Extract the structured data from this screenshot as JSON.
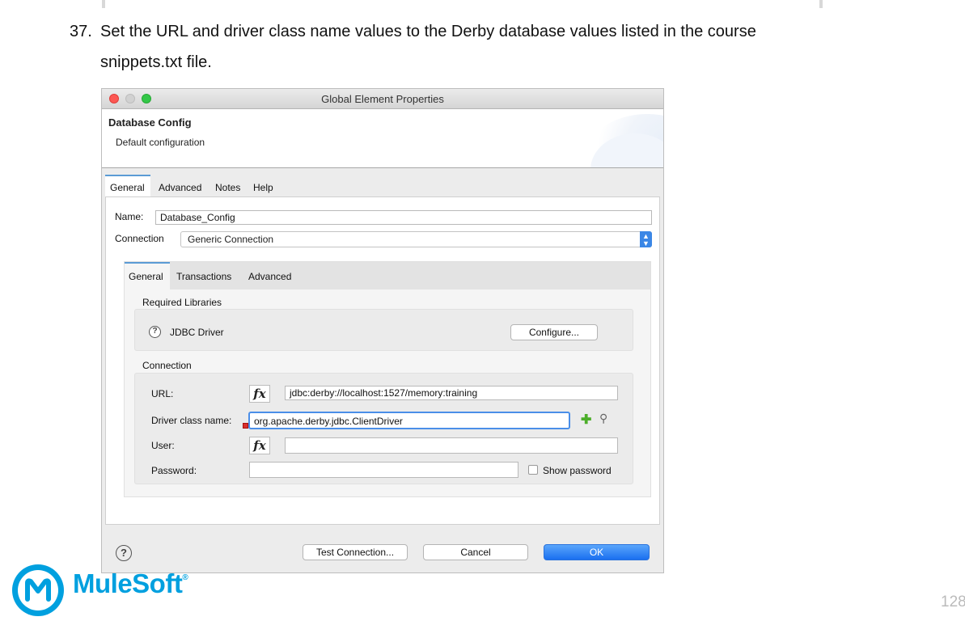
{
  "instruction": {
    "number": "37.",
    "line1": "Set the URL and driver class name values to the Derby database values listed in the course",
    "line2": "snippets.txt file."
  },
  "dialog": {
    "title": "Global Element Properties",
    "header": {
      "title": "Database Config",
      "subtitle": "Default configuration"
    },
    "tabs": [
      "General",
      "Advanced",
      "Notes",
      "Help"
    ],
    "name_label": "Name:",
    "name_value": "Database_Config",
    "connection_label": "Connection",
    "connection_value": "Generic Connection",
    "inner_tabs": [
      "General",
      "Transactions",
      "Advanced"
    ],
    "required_libraries_label": "Required Libraries",
    "jdbc_driver_label": "JDBC Driver",
    "configure_button": "Configure...",
    "connection_group_label": "Connection",
    "url_label": "URL:",
    "url_value": "jdbc:derby://localhost:1527/memory:training",
    "driver_label": "Driver class name:",
    "driver_value": "org.apache.derby.jdbc.ClientDriver",
    "user_label": "User:",
    "user_value": "",
    "password_label": "Password:",
    "password_value": "",
    "show_password_label": "Show password",
    "fx_label": "fx",
    "test_connection_button": "Test Connection...",
    "cancel_button": "Cancel",
    "ok_button": "OK"
  },
  "brand": {
    "name": "MuleSoft",
    "trademark": "®",
    "color": "#00a0df"
  },
  "page_number": "128",
  "colors": {
    "accent": "#3b87e6",
    "ok": "#1a6ff0",
    "tab_border": "#5b9bd5"
  }
}
